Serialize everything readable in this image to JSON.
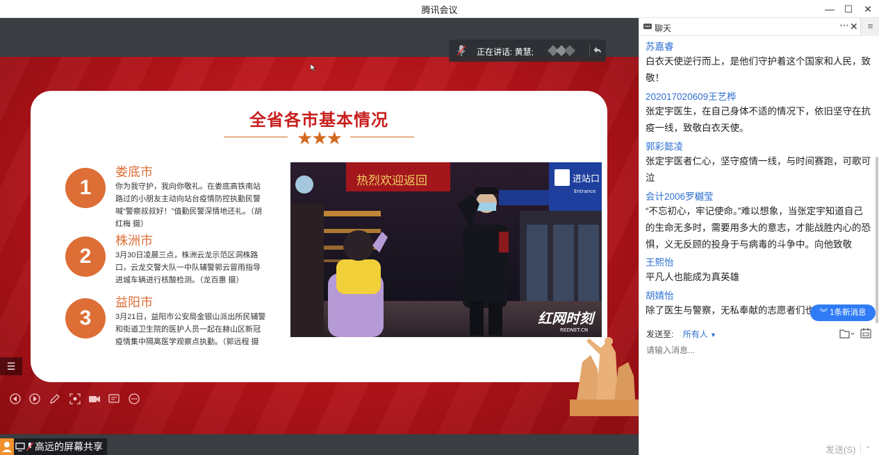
{
  "window": {
    "title": "腾讯会议"
  },
  "speaking": {
    "label": "正在讲话: 黄慧;"
  },
  "slide": {
    "heading": "全省各市基本情况",
    "stars": "★★★",
    "items": [
      {
        "num": "1",
        "city": "娄底市",
        "desc": "你为我守护，我向你敬礼。在娄底高铁南站路过的小朋友主动向站台疫情防控执勤民警喊“警察叔叔好！”值勤民警深情地还礼。（胡红梅 摄）"
      },
      {
        "num": "2",
        "city": "株洲市",
        "desc": "3月30日凌晨三点，株洲云龙示范区洞株路口，云龙交警大队一中队辅警郭云冒雨指导进城车辆进行核酸检测。（龙百惠 摄）"
      },
      {
        "num": "3",
        "city": "益阳市",
        "desc": "3月21日，益阳市公安局金银山派出所民辅警和街道卫生院的医护人员一起在赫山区新冠疫情集中隔离医学观察点执勤。（郭远程 摄"
      }
    ],
    "photo": {
      "sign_text": "进站口",
      "sign_sub": "Entrance",
      "banner": "热烈欢迎返回",
      "watermark": "红网时刻",
      "watermark_sub": "REDNET.CN"
    }
  },
  "sharer": {
    "label": "高远的屏幕共享"
  },
  "chat": {
    "title": "聊天",
    "messages": [
      {
        "name": "苏嘉睿",
        "text": "白衣天使逆行而上，是他们守护着这个国家和人民，致敬！"
      },
      {
        "name": "202017020609王艺桦",
        "text": "张定宇医生，在自己身体不适的情况下，依旧坚守在抗疫一线，致敬白衣天使。"
      },
      {
        "name": "郭彩懿凌",
        "text": "张定宇医者仁心，坚守疫情一线，与时间赛跑，可歌可泣"
      },
      {
        "name": "会计2006罗樾莹",
        "text": "“不忘初心，牢记使命。”难以想象，当张定宇知道自己的生命无多时，需要用多大的意志，才能战胜内心的恐惧，义无反顾的投身于与病毒的斗争中。向他致敬"
      },
      {
        "name": "王熙怡",
        "text": "平凡人也能成为真英雄"
      },
      {
        "name": "胡婧怡",
        "text": "除了医生与警察，无私奉献的志愿者们也值得我们致敬"
      }
    ],
    "new_messages": "1条新消息",
    "send_to_label": "发送至:",
    "send_to_target": "所有人",
    "input_placeholder": "请输入消息...",
    "send_button": "发送(S)"
  },
  "colors": {
    "accent": "#2f7cf6",
    "slide_red": "#c81d1d",
    "slide_orange": "#dd6e35"
  }
}
